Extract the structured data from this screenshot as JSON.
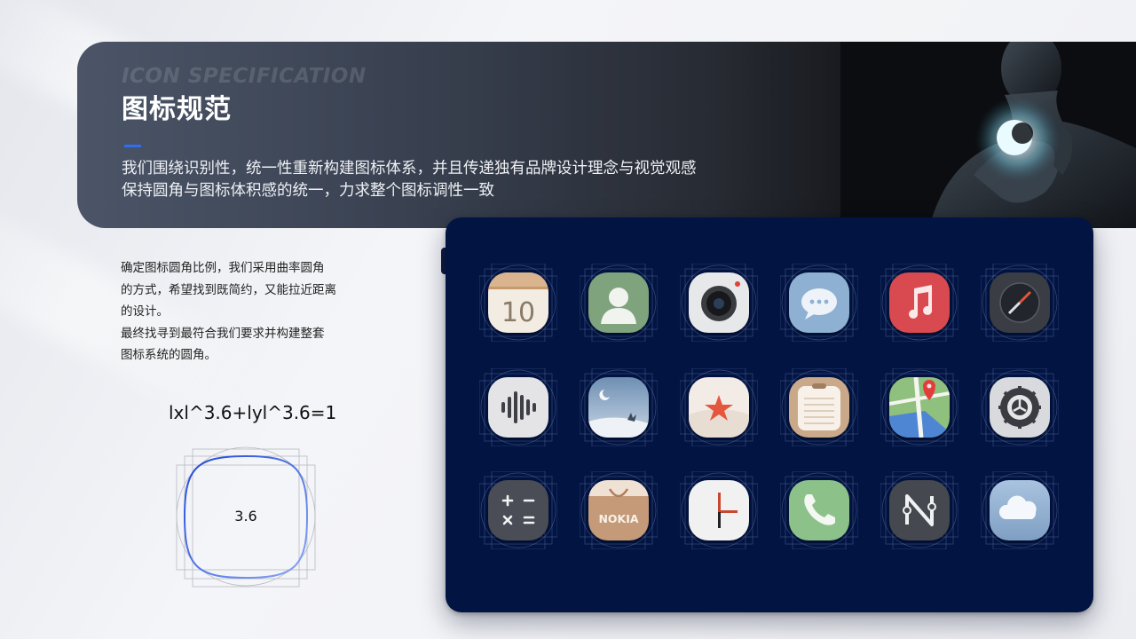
{
  "header": {
    "title_en": "ICON SPECIFICATION",
    "title": "图标规范",
    "description_lines": [
      "我们围绕识别性，统一性重新构建图标体系，并且传递独有品牌设计理念与视觉观感",
      "保持圆角与图标体积感的统一，力求整个图标调性一致"
    ]
  },
  "intro": {
    "lines": [
      "确定图标圆角比例，我们采用曲率圆角",
      "的方式，希望找到既简约，又能拉近距离",
      "的设计。",
      "最终找寻到最符合我们要求并构建整套",
      "图标系统的圆角。"
    ],
    "formula": "lxl^3.6+lyl^3.6=1",
    "curvature_label": "3.6"
  },
  "icons": {
    "calendar": {
      "name": "calendar-icon",
      "text": "10"
    },
    "contacts": {
      "name": "contacts-icon"
    },
    "camera": {
      "name": "camera-icon"
    },
    "messages": {
      "name": "messages-icon"
    },
    "music": {
      "name": "music-icon"
    },
    "compass": {
      "name": "compass-icon"
    },
    "recorder": {
      "name": "voice-recorder-icon"
    },
    "weather_night": {
      "name": "weather-night-icon"
    },
    "favorites": {
      "name": "favorites-star-icon"
    },
    "notes": {
      "name": "notes-icon"
    },
    "maps": {
      "name": "maps-icon"
    },
    "settings": {
      "name": "settings-gear-icon"
    },
    "calculator": {
      "name": "calculator-icon"
    },
    "store": {
      "name": "nokia-store-icon",
      "text": "NOKIA"
    },
    "clock": {
      "name": "clock-icon"
    },
    "phone": {
      "name": "phone-icon"
    },
    "n_app": {
      "name": "n-app-icon"
    },
    "cloud": {
      "name": "cloud-icon"
    }
  },
  "colors": {
    "accent": "#2e6ef5",
    "panel": "#021442"
  }
}
